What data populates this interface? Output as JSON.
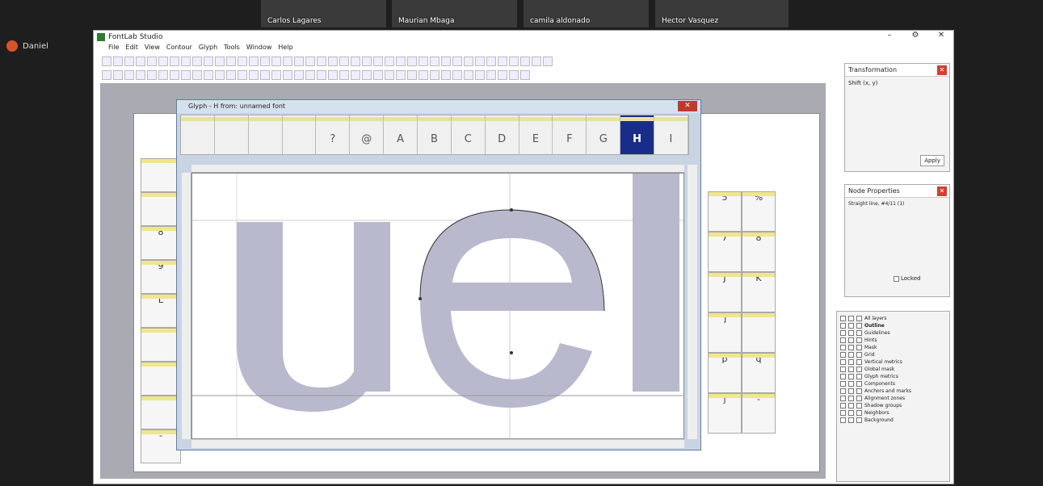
{
  "participants": [
    "Carlos Lagares",
    "Maurian Mbaga",
    "camila aldonado",
    "Hector Vasquez"
  ],
  "presenter_label": "Daniel",
  "app": {
    "title": "FontLab Studio",
    "menu": [
      "File",
      "Edit",
      "View",
      "Contour",
      "Glyph",
      "Tools",
      "Window",
      "Help"
    ]
  },
  "glyph_window": {
    "title": "Glyph - H from: unnamed font",
    "strip": [
      "",
      "",
      "",
      "",
      "?",
      "@",
      "A",
      "B",
      "C",
      "D",
      "E",
      "F",
      "G",
      "H",
      "I"
    ],
    "selected": "H"
  },
  "canvas_text": "uel",
  "font_cells_left": [
    "",
    "",
    "8",
    "9",
    "L",
    "",
    "",
    "",
    "-"
  ],
  "font_cells_right": [
    "5",
    "%",
    "7",
    "8",
    "J",
    "K",
    "]",
    "`",
    "p",
    "q",
    "j",
    "-"
  ],
  "transformation": {
    "title": "Transformation",
    "label": "Shift (x, y)",
    "apply_label": "Apply"
  },
  "node_properties": {
    "title": "Node Properties",
    "subtitle": "Straight line, #4/11 (1)",
    "checkbox_label": "Locked"
  },
  "layers": [
    "All layers",
    "Outline",
    "Guidelines",
    "Hints",
    "Mask",
    "Grid",
    "Vertical metrics",
    "Global mask",
    "Glyph metrics",
    "Components",
    "Anchors and marks",
    "Alignment zones",
    "Shadow groups",
    "Neighbors",
    "Background"
  ],
  "colors": {
    "accent": "#1a2c8a",
    "shape": "#b8b9cd",
    "red": "#d43e2e"
  },
  "icons": [
    "close-icon",
    "minimize-icon",
    "maximize-icon",
    "checkbox-icon"
  ]
}
